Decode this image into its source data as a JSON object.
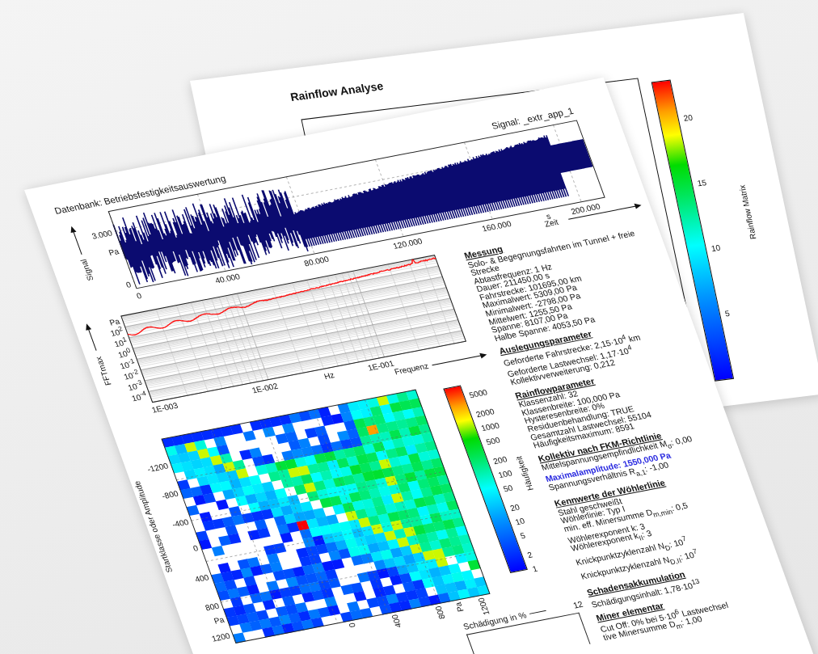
{
  "back_sheet": {
    "title": "Rainflow Analyse",
    "colorbar": {
      "label": "Rainflow Matrix",
      "ticks": [
        "20",
        "15",
        "10",
        "5"
      ]
    }
  },
  "front_sheet": {
    "database_label": "Datenbank: Betriebsfestigkeitsauswertung",
    "signal_label": "Signal: _extr_app_1",
    "signal_chart": {
      "y_title": "Signal",
      "y_unit": "Pa",
      "y_ticks": [
        "3.000",
        "0"
      ],
      "x_ticks": [
        "0",
        "40.000",
        "80.000",
        "120.000",
        "160.000",
        "200.000"
      ],
      "x_unit": "s",
      "x_title": "Zeit"
    },
    "fft_chart": {
      "y_title": "FFTmax",
      "y_unit": "Pa",
      "y_ticks": [
        "10$^{2}$",
        "10$^{1}$",
        "10$^{0}$",
        "10$^{-1}$",
        "10$^{-2}$",
        "10$^{-3}$",
        "10$^{-4}$"
      ],
      "x_ticks": [
        "1E-003",
        "1E-002",
        "1E-001"
      ],
      "x_unit": "Hz",
      "x_title": "Frequenz"
    },
    "rainflow_matrix": {
      "y_title": "Startklasse oder Amplitude",
      "y_ticks": [
        "-1200",
        "-800",
        "-400",
        "0",
        "400",
        "800",
        "Pa",
        "1200"
      ],
      "x_ticks": [
        "0",
        "400",
        "800",
        "Pa",
        "1200"
      ],
      "colorbar": {
        "label": "Häufigkeit",
        "ticks": [
          "5000",
          "2000",
          "1000",
          "500",
          "200",
          "100",
          "50",
          "20",
          "10",
          "5",
          "2",
          "1"
        ]
      }
    },
    "damage_chart": {
      "x_title": "Schädigung in %",
      "tick": "12"
    },
    "sections": [
      {
        "heading": "Messung",
        "lines": [
          {
            "kind": "plain",
            "text": "Solo- & Begegnungsfahrten im Tunnel + freie"
          },
          {
            "kind": "plain",
            "text": "Strecke"
          },
          {
            "kind": "plain",
            "text": "Abtastfrequenz: 1 Hz"
          },
          {
            "kind": "plain",
            "text": "Dauer: 211450,00 s"
          },
          {
            "kind": "plain",
            "text": "Fahrstrecke: 101695,00  km"
          },
          {
            "kind": "plain",
            "text": "Maximalwert: 5309,00 Pa"
          },
          {
            "kind": "plain",
            "text": "Minimalwert: -2798,00 Pa"
          },
          {
            "kind": "plain",
            "text": "Mittelwert: 1255,50 Pa"
          },
          {
            "kind": "plain",
            "text": "Spanne: 8107,00 Pa"
          },
          {
            "kind": "plain",
            "text": "Halbe Spanne: 4053,50 Pa"
          }
        ]
      },
      {
        "heading": "Auslegungsparameter",
        "lines": [
          {
            "kind": "plain",
            "text": "Geforderte Fahrstrecke: 2,15·10$^{4}$ km"
          },
          {
            "kind": "plain",
            "text": "Geforderte Lastwechsel: 1,17·10$^{4}$"
          },
          {
            "kind": "plain",
            "text": "Kollektivverweiterung: 0,212"
          }
        ]
      },
      {
        "heading": "Rainflowparameter",
        "lines": [
          {
            "kind": "plain",
            "text": "Klassenzahl: 32"
          },
          {
            "kind": "plain",
            "text": "Klassenbreite: 100,000 Pa"
          },
          {
            "kind": "plain",
            "text": "Hysteresenbreite: 0%"
          },
          {
            "kind": "plain",
            "text": "Residuenbehandlung: TRUE"
          },
          {
            "kind": "plain",
            "text": "Gesamtzahl Lastwechsel: 55104"
          },
          {
            "kind": "plain",
            "text": "Häufigkeitsmaximum: 8591"
          }
        ]
      },
      {
        "heading": "Kollektiv nach FKM-Richtlinie",
        "lines": [
          {
            "kind": "plain",
            "text": "Mittelspannungsempfindlichkeit M$_{σ}$: 0,00"
          },
          {
            "kind": "highlight",
            "text": "Maximalamplitude: 1550,000 Pa"
          },
          {
            "kind": "plain",
            "text": "Spannungsverhältnis R$_{a,1}$: -1,00"
          }
        ]
      },
      {
        "heading": "Kennwerte der Wöhlerlinie",
        "lines": [
          {
            "kind": "plain",
            "text": "Stahl geschweißt"
          },
          {
            "kind": "plain",
            "text": "Wöhlerlinie: Typ I"
          },
          {
            "kind": "plain",
            "text": "min. eff. Minersumme D$_{m,min}$: 0,5"
          },
          {
            "kind": "plain",
            "text": "Wöhlerexponent k: 3"
          },
          {
            "kind": "plain",
            "text": "Wöhlerexponent k$_{II}$: 3"
          },
          {
            "kind": "plain",
            "text": "Knickpunktzyklenzahl N$_{D}$: 10$^{7}$"
          },
          {
            "kind": "plain",
            "text": "Knickpunktzyklenzahl N$_{D,II}$: 10$^{7}$"
          }
        ]
      },
      {
        "heading": "Schadensakkumulation",
        "lines": [
          {
            "kind": "plain",
            "text": "Schädigungsinhalt: 1,78·10$^{13}$"
          }
        ]
      },
      {
        "heading": "Miner elementar",
        "lines": [
          {
            "kind": "plain",
            "text": "Cut Off: 0% bei 5·10$^{6}$ Lastwechsel"
          },
          {
            "kind": "plain",
            "text": "tive Minersumme D$_{m}$: 1,00"
          }
        ]
      }
    ]
  }
}
